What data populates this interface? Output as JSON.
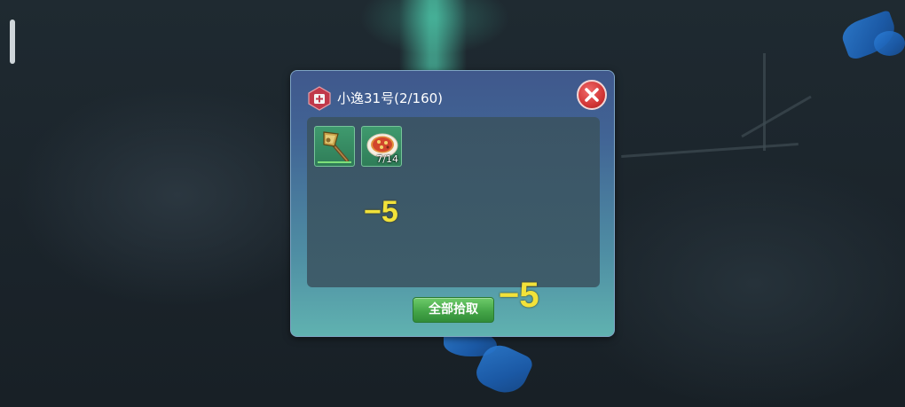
{
  "dialog": {
    "title": "小逸31号(2/160)",
    "loot_all_label": "全部拾取",
    "items": [
      {
        "name": "axe",
        "count": ""
      },
      {
        "name": "pizza",
        "count": "7/14"
      }
    ]
  },
  "floating_numbers": [
    "−5",
    "−5"
  ],
  "colors": {
    "dialog_top": "#40588c",
    "dialog_bottom": "#60b2b0",
    "slot": "#3f9a6e",
    "close_button": "#d23636",
    "loot_button": "#45a648",
    "damage_text": "#f2e23a"
  }
}
